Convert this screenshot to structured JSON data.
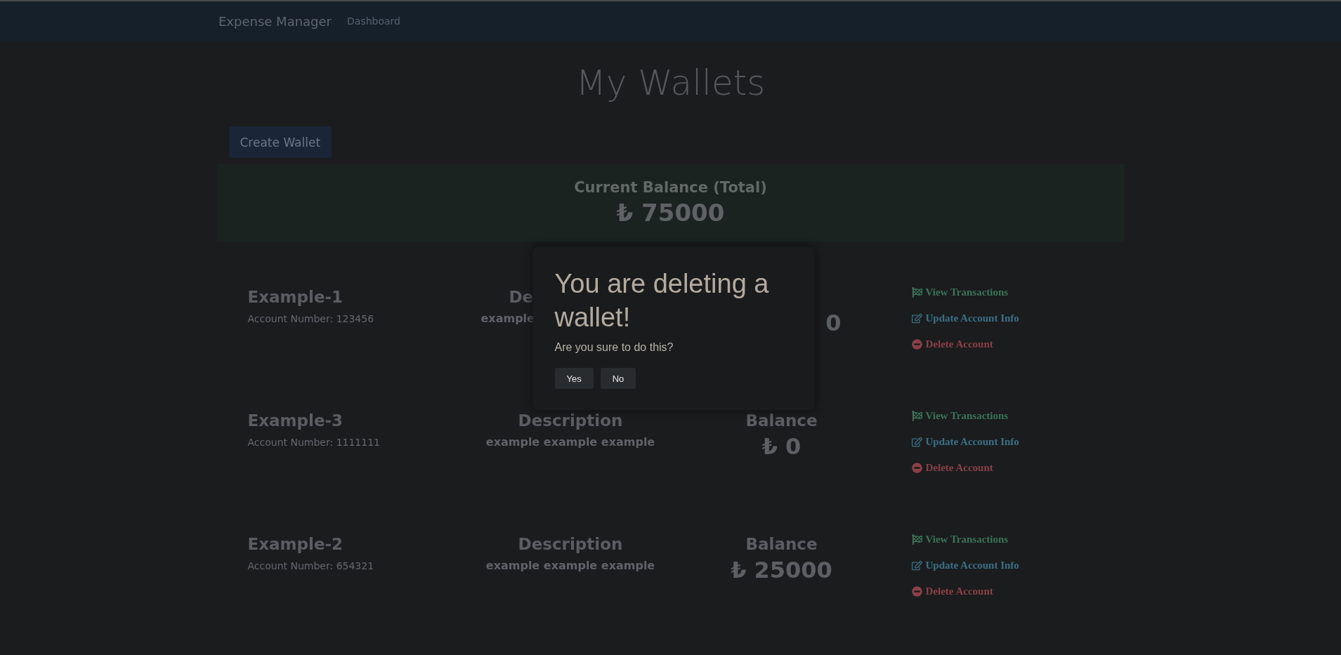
{
  "navbar": {
    "brand": "Expense Manager",
    "links": [
      "Dashboard"
    ]
  },
  "page_title": "My Wallets",
  "create_button": "Create Wallet",
  "total": {
    "label": "Current Balance (Total)",
    "amount": "₺ 75000"
  },
  "wallets": [
    {
      "covered": true,
      "name": "Example-1",
      "account": "Account Number: 123456",
      "description_label": "De",
      "description": "example",
      "balance": "0",
      "actions": [
        {
          "kind": "view",
          "label": "View Transactions"
        },
        {
          "kind": "update",
          "label": "Update Account Info"
        },
        {
          "kind": "delete",
          "label": "Delete Account"
        }
      ]
    },
    {
      "covered": false,
      "name": "Example-3",
      "account": "Account Number: 1111111",
      "description_label": "Description",
      "description": "example example example",
      "balance_label": "Balance",
      "balance": "₺ 0",
      "actions": [
        {
          "kind": "view",
          "label": "View Transactions"
        },
        {
          "kind": "update",
          "label": "Update Account Info"
        },
        {
          "kind": "delete",
          "label": "Delete Account"
        }
      ]
    },
    {
      "covered": false,
      "name": "Example-2",
      "account": "Account Number: 654321",
      "description_label": "Description",
      "description": "example example example",
      "balance_label": "Balance",
      "balance": "₺ 25000",
      "actions": [
        {
          "kind": "view",
          "label": "View Transactions"
        },
        {
          "kind": "update",
          "label": "Update Account Info"
        },
        {
          "kind": "delete",
          "label": "Delete Account"
        }
      ]
    }
  ],
  "dialog": {
    "title": "You are deleting a wallet!",
    "message": "Are you sure to do this?",
    "buttons": [
      "Yes",
      "No"
    ]
  }
}
